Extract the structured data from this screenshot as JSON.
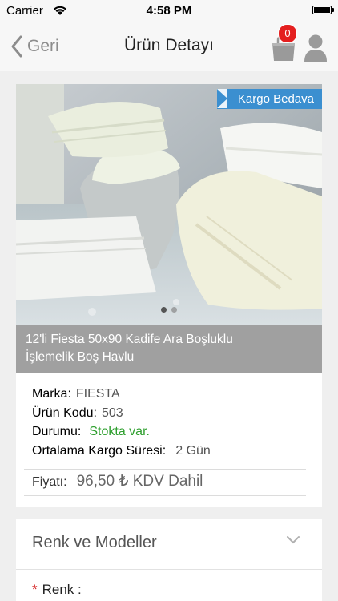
{
  "status": {
    "carrier": "Carrier",
    "time": "4:58 PM"
  },
  "nav": {
    "back_label": "Geri",
    "title": "Ürün Detayı",
    "cart_count": "0"
  },
  "product": {
    "badge": "Kargo Bedava",
    "title_line1": "12'li Fiesta 50x90 Kadife Ara Boşluklu",
    "title_line2": "İşlemelik Boş Havlu",
    "brand_label": "Marka:",
    "brand": "FIESTA",
    "code_label": "Ürün Kodu:",
    "code": "503",
    "status_label": "Durumu:",
    "status": "Stokta var.",
    "shipping_label": "Ortalama Kargo Süresi:",
    "shipping": "2 Gün",
    "price_label": "Fiyatı:",
    "price": "96,50 ₺ KDV Dahil",
    "image_page": 1,
    "image_count": 2
  },
  "variants": {
    "section_title": "Renk ve Modeller",
    "color_required": "*",
    "color_label": "Renk :"
  },
  "colors": {
    "accent": "#3b8fd0",
    "badge": "#e41f1f",
    "stock": "#2e9f2e",
    "title_bg": "#a0a0a0"
  },
  "icons": [
    "chevron-left-icon",
    "cart-icon",
    "user-icon",
    "wifi-icon",
    "battery-icon",
    "chevron-down-icon"
  ]
}
